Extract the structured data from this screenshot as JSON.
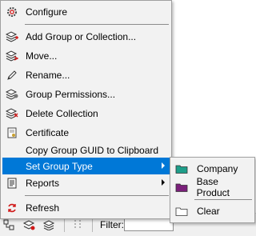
{
  "filter": {
    "label": "Filter:"
  },
  "menu": {
    "items": [
      {
        "label": "Configure",
        "icon": "gear-icon"
      },
      {
        "label": "Add Group or Collection...",
        "icon": "add-group-icon"
      },
      {
        "label": "Move...",
        "icon": "move-icon"
      },
      {
        "label": "Rename...",
        "icon": "pencil-icon"
      },
      {
        "label": "Group Permissions...",
        "icon": "permissions-icon"
      },
      {
        "label": "Delete Collection",
        "icon": "delete-icon"
      },
      {
        "label": "Certificate",
        "icon": "certificate-icon"
      },
      {
        "label": "Copy Group GUID to Clipboard",
        "icon": ""
      },
      {
        "label": "Set Group Type",
        "icon": "",
        "highlighted": true
      },
      {
        "label": "Reports",
        "icon": "report-icon"
      },
      {
        "label": "Refresh",
        "icon": "refresh-icon"
      }
    ]
  },
  "submenu": {
    "items": [
      {
        "label": "Company",
        "icon": "folder-icon",
        "color": "#1e9e8a"
      },
      {
        "label": "Base Product",
        "icon": "folder-icon",
        "color": "#7a1f7a"
      },
      {
        "label": "Clear",
        "icon": "folder-outline-icon"
      }
    ]
  },
  "colors": {
    "highlight": "#0078d7",
    "accent_red": "#d01818"
  }
}
